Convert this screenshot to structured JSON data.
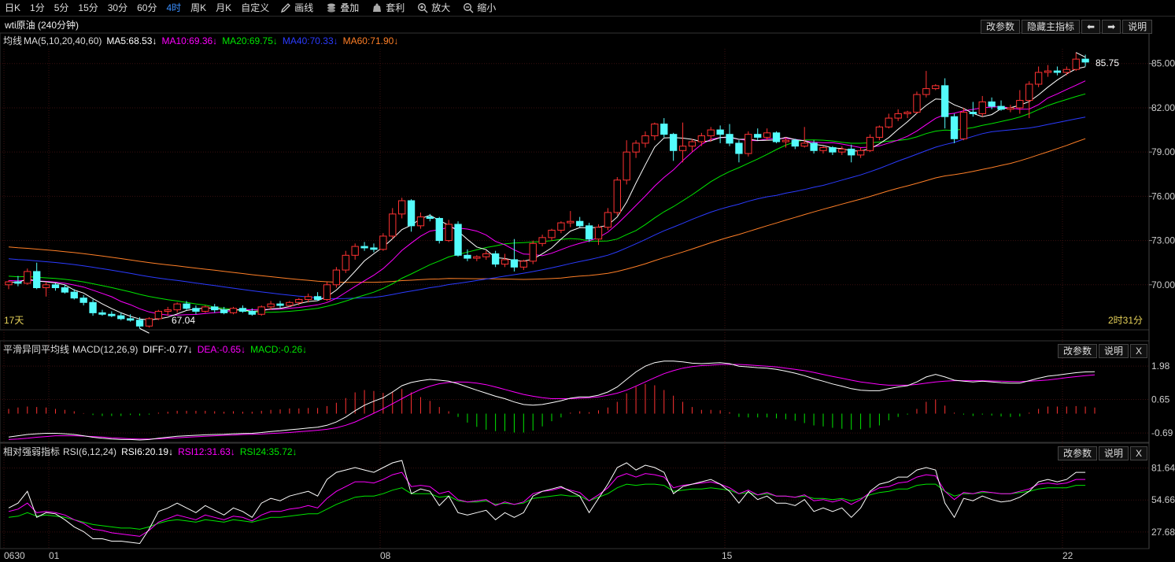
{
  "toolbar": {
    "periods": [
      "日K",
      "1分",
      "5分",
      "15分",
      "30分",
      "60分",
      "4时",
      "周K",
      "月K",
      "自定义"
    ],
    "active_period": "4时",
    "tools": [
      {
        "label": "画线",
        "icon": "pencil-icon"
      },
      {
        "label": "叠加",
        "icon": "stack-icon"
      },
      {
        "label": "套利",
        "icon": "bag-icon"
      },
      {
        "label": "放大",
        "icon": "zoom-in-icon"
      },
      {
        "label": "缩小",
        "icon": "zoom-out-icon"
      }
    ]
  },
  "title": "wti原油 (240分钟)",
  "main_panel": {
    "buttons": [
      "改参数",
      "隐藏主指标",
      "⬅",
      "➡",
      "说明"
    ],
    "legend": {
      "name": "均线",
      "params": "MA(5,10,20,40,60)",
      "ma5": "MA5:68.53↓",
      "ma10": "MA10:69.36↓",
      "ma20": "MA20:69.75↓",
      "ma40": "MA40:70.33↓",
      "ma60": "MA60:71.90↓"
    },
    "y_ticks": [
      "85.00",
      "82.00",
      "79.00",
      "76.00",
      "73.00",
      "70.00"
    ],
    "low_label": "67.04",
    "high_label": "85.75",
    "left_info": "17天",
    "right_info": "2时31分"
  },
  "macd_panel": {
    "buttons": [
      "改参数",
      "说明",
      "X"
    ],
    "legend": {
      "name": "平滑异同平均线",
      "params": "MACD(12,26,9)",
      "diff": "DIFF:-0.77↓",
      "dea": "DEA:-0.65↓",
      "macd": "MACD:-0.26↓"
    },
    "y_ticks": [
      "1.98",
      "0.65",
      "-0.69"
    ]
  },
  "rsi_panel": {
    "buttons": [
      "改参数",
      "说明",
      "X"
    ],
    "legend": {
      "name": "相对强弱指标",
      "params": "RSI(6,12,24)",
      "rsi6": "RSI6:20.19↓",
      "rsi12": "RSI12:31.63↓",
      "rsi24": "RSI24:35.72↓"
    },
    "y_ticks": [
      "81.64",
      "54.66",
      "27.68"
    ]
  },
  "x_labels": [
    "0630",
    "01",
    "08",
    "15",
    "22"
  ],
  "colors": {
    "up": "#ff3232",
    "down": "#54fcfc",
    "ma5": "#ffffff",
    "ma10": "#ff00ff",
    "ma20": "#00e600",
    "ma40": "#2b3bff",
    "ma60": "#ff7f27",
    "grid": "#3a1010",
    "legend_yellow": "#e8d35a"
  },
  "chart_data": {
    "type": "candlestick",
    "price_range": [
      67.0,
      86.0
    ],
    "candles": [
      [
        70.0,
        70.3,
        69.7,
        70.2
      ],
      [
        70.2,
        70.6,
        69.9,
        70.1
      ],
      [
        70.1,
        71.1,
        70.0,
        70.9
      ],
      [
        70.9,
        71.5,
        69.7,
        69.8
      ],
      [
        69.8,
        70.2,
        69.2,
        70.0
      ],
      [
        70.0,
        70.1,
        69.6,
        69.8
      ],
      [
        69.8,
        70.0,
        69.4,
        69.5
      ],
      [
        69.5,
        69.7,
        69.0,
        69.1
      ],
      [
        69.1,
        69.3,
        68.6,
        68.8
      ],
      [
        68.8,
        69.0,
        67.9,
        68.1
      ],
      [
        68.1,
        68.3,
        67.9,
        68.0
      ],
      [
        68.0,
        68.2,
        67.8,
        67.9
      ],
      [
        67.9,
        68.1,
        67.6,
        67.7
      ],
      [
        67.7,
        68.0,
        67.5,
        67.6
      ],
      [
        67.6,
        67.8,
        67.04,
        67.2
      ],
      [
        67.2,
        67.8,
        67.1,
        67.7
      ],
      [
        67.7,
        68.3,
        67.6,
        68.2
      ],
      [
        68.2,
        68.5,
        67.9,
        68.3
      ],
      [
        68.3,
        68.8,
        68.1,
        68.7
      ],
      [
        68.7,
        68.9,
        68.3,
        68.4
      ],
      [
        68.4,
        68.6,
        68.0,
        68.2
      ],
      [
        68.2,
        68.6,
        68.1,
        68.5
      ],
      [
        68.5,
        68.7,
        68.1,
        68.3
      ],
      [
        68.3,
        68.5,
        68.0,
        68.1
      ],
      [
        68.1,
        68.5,
        68.0,
        68.4
      ],
      [
        68.4,
        68.6,
        68.1,
        68.2
      ],
      [
        68.2,
        68.4,
        67.9,
        68.0
      ],
      [
        68.0,
        68.6,
        67.9,
        68.5
      ],
      [
        68.5,
        68.9,
        68.3,
        68.7
      ],
      [
        68.7,
        68.9,
        68.4,
        68.6
      ],
      [
        68.6,
        68.9,
        68.5,
        68.8
      ],
      [
        68.8,
        69.1,
        68.6,
        69.0
      ],
      [
        69.0,
        69.4,
        68.8,
        69.2
      ],
      [
        69.2,
        69.5,
        68.9,
        69.0
      ],
      [
        69.0,
        70.2,
        68.9,
        70.0
      ],
      [
        70.0,
        71.2,
        69.8,
        71.0
      ],
      [
        71.0,
        72.3,
        70.8,
        72.0
      ],
      [
        72.0,
        72.8,
        71.7,
        72.6
      ],
      [
        72.6,
        72.9,
        72.3,
        72.5
      ],
      [
        72.5,
        72.8,
        72.2,
        72.4
      ],
      [
        72.4,
        73.5,
        72.3,
        73.3
      ],
      [
        73.3,
        75.2,
        73.1,
        74.8
      ],
      [
        74.8,
        75.9,
        74.5,
        75.7
      ],
      [
        75.7,
        75.8,
        73.6,
        74.0
      ],
      [
        74.0,
        74.9,
        73.8,
        74.6
      ],
      [
        74.6,
        74.8,
        74.3,
        74.5
      ],
      [
        74.5,
        74.6,
        72.8,
        73.0
      ],
      [
        73.0,
        74.4,
        72.9,
        74.1
      ],
      [
        74.1,
        74.3,
        71.9,
        72.0
      ],
      [
        72.0,
        72.4,
        71.6,
        71.8
      ],
      [
        71.8,
        72.0,
        71.6,
        71.9
      ],
      [
        71.9,
        72.3,
        71.7,
        72.1
      ],
      [
        72.1,
        72.3,
        71.2,
        71.4
      ],
      [
        71.4,
        72.1,
        71.2,
        71.7
      ],
      [
        71.7,
        73.1,
        70.9,
        71.2
      ],
      [
        71.2,
        71.7,
        71.0,
        71.6
      ],
      [
        71.6,
        73.0,
        71.4,
        72.8
      ],
      [
        72.8,
        73.4,
        72.6,
        73.2
      ],
      [
        73.2,
        73.8,
        73.0,
        73.7
      ],
      [
        73.7,
        74.3,
        73.5,
        74.2
      ],
      [
        74.2,
        75.0,
        73.9,
        74.3
      ],
      [
        74.3,
        74.6,
        73.9,
        74.0
      ],
      [
        74.0,
        74.2,
        72.9,
        73.1
      ],
      [
        73.1,
        74.1,
        72.7,
        73.9
      ],
      [
        73.9,
        75.2,
        73.7,
        74.9
      ],
      [
        74.9,
        77.3,
        74.7,
        77.1
      ],
      [
        77.1,
        79.8,
        76.8,
        79.0
      ],
      [
        79.0,
        79.8,
        78.6,
        79.6
      ],
      [
        79.6,
        80.4,
        79.3,
        80.1
      ],
      [
        80.1,
        81.0,
        79.8,
        80.9
      ],
      [
        80.9,
        81.3,
        80.0,
        80.2
      ],
      [
        80.2,
        80.3,
        78.4,
        79.1
      ],
      [
        79.1,
        81.0,
        78.3,
        79.4
      ],
      [
        79.4,
        79.9,
        79.0,
        79.7
      ],
      [
        79.7,
        80.3,
        79.4,
        80.1
      ],
      [
        80.1,
        80.7,
        79.7,
        80.5
      ],
      [
        80.5,
        80.8,
        79.6,
        80.2
      ],
      [
        80.2,
        80.9,
        79.4,
        79.6
      ],
      [
        79.6,
        79.8,
        78.3,
        78.9
      ],
      [
        78.9,
        80.4,
        78.7,
        80.2
      ],
      [
        80.2,
        80.6,
        79.8,
        80.0
      ],
      [
        80.0,
        80.6,
        79.8,
        80.3
      ],
      [
        80.3,
        80.4,
        79.6,
        79.7
      ],
      [
        79.7,
        80.0,
        79.3,
        79.8
      ],
      [
        79.8,
        79.9,
        79.2,
        79.4
      ],
      [
        79.4,
        80.7,
        79.3,
        79.6
      ],
      [
        79.6,
        79.8,
        78.9,
        79.1
      ],
      [
        79.1,
        79.4,
        78.9,
        79.3
      ],
      [
        79.3,
        79.4,
        78.8,
        79.0
      ],
      [
        79.0,
        79.4,
        78.8,
        79.2
      ],
      [
        79.2,
        79.5,
        78.3,
        78.8
      ],
      [
        78.8,
        79.3,
        78.6,
        79.1
      ],
      [
        79.1,
        80.2,
        79.0,
        80.0
      ],
      [
        80.0,
        80.8,
        79.8,
        80.7
      ],
      [
        80.7,
        81.6,
        80.6,
        81.3
      ],
      [
        81.3,
        81.9,
        81.1,
        81.6
      ],
      [
        81.6,
        81.8,
        81.3,
        81.7
      ],
      [
        81.7,
        83.1,
        81.6,
        82.9
      ],
      [
        82.9,
        84.5,
        82.7,
        83.3
      ],
      [
        83.3,
        83.6,
        83.2,
        83.5
      ],
      [
        83.5,
        84.0,
        80.6,
        81.4
      ],
      [
        81.4,
        81.6,
        79.6,
        79.9
      ],
      [
        79.9,
        82.0,
        79.8,
        81.7
      ],
      [
        81.7,
        82.4,
        81.4,
        81.6
      ],
      [
        81.6,
        82.8,
        81.4,
        82.4
      ],
      [
        82.4,
        82.7,
        81.9,
        82.1
      ],
      [
        82.1,
        82.5,
        81.8,
        81.9
      ],
      [
        81.9,
        82.2,
        81.7,
        82.0
      ],
      [
        82.0,
        83.2,
        81.6,
        82.5
      ],
      [
        82.5,
        83.8,
        81.3,
        83.6
      ],
      [
        83.6,
        84.8,
        83.4,
        84.4
      ],
      [
        84.4,
        84.9,
        84.1,
        84.5
      ],
      [
        84.5,
        84.8,
        84.2,
        84.4
      ],
      [
        84.4,
        84.8,
        84.2,
        84.6
      ],
      [
        84.6,
        85.75,
        84.5,
        85.3
      ],
      [
        85.3,
        85.6,
        84.8,
        85.1
      ]
    ],
    "macd": {
      "range": [
        -1.0,
        2.3
      ],
      "diff": [
        -0.85,
        -0.8,
        -0.75,
        -0.72,
        -0.7,
        -0.7,
        -0.72,
        -0.75,
        -0.8,
        -0.86,
        -0.9,
        -0.93,
        -0.95,
        -0.95,
        -0.97,
        -0.95,
        -0.9,
        -0.86,
        -0.82,
        -0.8,
        -0.78,
        -0.76,
        -0.75,
        -0.74,
        -0.72,
        -0.71,
        -0.7,
        -0.67,
        -0.63,
        -0.6,
        -0.56,
        -0.53,
        -0.49,
        -0.46,
        -0.38,
        -0.25,
        -0.05,
        0.2,
        0.42,
        0.58,
        0.72,
        0.95,
        1.2,
        1.33,
        1.4,
        1.45,
        1.42,
        1.38,
        1.28,
        1.15,
        1.02,
        0.9,
        0.78,
        0.68,
        0.55,
        0.45,
        0.42,
        0.45,
        0.52,
        0.6,
        0.7,
        0.75,
        0.75,
        0.82,
        0.95,
        1.15,
        1.45,
        1.75,
        1.98,
        2.12,
        2.18,
        2.18,
        2.15,
        2.1,
        2.08,
        2.1,
        2.12,
        2.08,
        1.98,
        1.95,
        1.92,
        1.9,
        1.85,
        1.78,
        1.7,
        1.6,
        1.48,
        1.38,
        1.27,
        1.18,
        1.08,
        1.02,
        1.0,
        1.0,
        1.08,
        1.15,
        1.2,
        1.35,
        1.55,
        1.65,
        1.55,
        1.42,
        1.38,
        1.35,
        1.38,
        1.35,
        1.32,
        1.3,
        1.3,
        1.4,
        1.5,
        1.58,
        1.62,
        1.67,
        1.72,
        1.75,
        1.76
      ],
      "dea": [
        -0.95,
        -0.93,
        -0.9,
        -0.86,
        -0.83,
        -0.8,
        -0.8,
        -0.8,
        -0.81,
        -0.83,
        -0.85,
        -0.88,
        -0.9,
        -0.92,
        -0.93,
        -0.93,
        -0.92,
        -0.9,
        -0.88,
        -0.86,
        -0.84,
        -0.82,
        -0.8,
        -0.78,
        -0.77,
        -0.75,
        -0.74,
        -0.73,
        -0.71,
        -0.69,
        -0.67,
        -0.64,
        -0.61,
        -0.58,
        -0.54,
        -0.48,
        -0.38,
        -0.25,
        -0.08,
        0.1,
        0.28,
        0.48,
        0.68,
        0.88,
        1.05,
        1.18,
        1.28,
        1.33,
        1.35,
        1.34,
        1.3,
        1.24,
        1.15,
        1.05,
        0.95,
        0.85,
        0.78,
        0.72,
        0.68,
        0.68,
        0.68,
        0.7,
        0.72,
        0.75,
        0.82,
        0.9,
        1.02,
        1.18,
        1.35,
        1.52,
        1.68,
        1.8,
        1.9,
        1.96,
        2.0,
        2.02,
        2.05,
        2.05,
        2.05,
        2.03,
        2.0,
        1.98,
        1.95,
        1.9,
        1.85,
        1.8,
        1.73,
        1.65,
        1.57,
        1.5,
        1.42,
        1.35,
        1.3,
        1.25,
        1.22,
        1.22,
        1.22,
        1.25,
        1.3,
        1.35,
        1.38,
        1.4,
        1.4,
        1.4,
        1.4,
        1.39,
        1.38,
        1.37,
        1.36,
        1.38,
        1.4,
        1.43,
        1.47,
        1.52,
        1.56,
        1.6,
        1.63
      ]
    },
    "rsi": {
      "range": [
        15,
        88
      ],
      "rsi6": [
        48,
        52,
        62,
        40,
        44,
        43,
        38,
        32,
        28,
        22,
        22,
        20,
        20,
        19,
        18,
        30,
        45,
        48,
        52,
        48,
        44,
        50,
        46,
        42,
        48,
        45,
        40,
        52,
        56,
        54,
        58,
        60,
        62,
        58,
        72,
        78,
        80,
        82,
        80,
        78,
        82,
        86,
        88,
        60,
        64,
        62,
        50,
        58,
        44,
        42,
        44,
        46,
        38,
        44,
        40,
        44,
        58,
        62,
        64,
        66,
        62,
        58,
        44,
        56,
        68,
        82,
        86,
        80,
        84,
        82,
        78,
        60,
        66,
        68,
        70,
        72,
        68,
        62,
        52,
        62,
        55,
        58,
        52,
        52,
        50,
        55,
        45,
        48,
        45,
        48,
        40,
        48,
        62,
        68,
        70,
        74,
        74,
        80,
        82,
        80,
        52,
        40,
        56,
        54,
        58,
        55,
        53,
        54,
        57,
        62,
        70,
        72,
        70,
        72,
        78,
        78
      ],
      "rsi12": [
        45,
        47,
        52,
        44,
        45,
        44,
        42,
        38,
        35,
        30,
        29,
        27,
        26,
        25,
        24,
        29,
        36,
        39,
        42,
        40,
        38,
        42,
        40,
        38,
        41,
        40,
        37,
        42,
        45,
        45,
        47,
        48,
        50,
        48,
        56,
        62,
        66,
        70,
        70,
        69,
        72,
        76,
        78,
        66,
        67,
        66,
        60,
        62,
        55,
        53,
        54,
        55,
        50,
        53,
        51,
        53,
        60,
        62,
        63,
        65,
        63,
        61,
        54,
        59,
        65,
        74,
        77,
        74,
        77,
        76,
        74,
        65,
        67,
        68,
        69,
        70,
        68,
        65,
        60,
        63,
        59,
        61,
        58,
        58,
        57,
        59,
        54,
        55,
        53,
        55,
        51,
        55,
        61,
        65,
        66,
        69,
        70,
        74,
        76,
        75,
        62,
        55,
        61,
        60,
        62,
        61,
        60,
        60,
        62,
        64,
        68,
        69,
        68,
        69,
        72,
        72
      ],
      "rsi24": [
        40,
        41,
        44,
        41,
        42,
        41,
        40,
        38,
        36,
        34,
        33,
        32,
        31,
        31,
        30,
        32,
        35,
        37,
        38,
        37,
        36,
        38,
        37,
        36,
        38,
        37,
        36,
        38,
        40,
        40,
        41,
        42,
        43,
        43,
        47,
        51,
        54,
        57,
        58,
        58,
        60,
        63,
        65,
        60,
        60,
        60,
        57,
        58,
        54,
        53,
        53,
        54,
        51,
        52,
        51,
        52,
        56,
        57,
        58,
        59,
        58,
        58,
        54,
        57,
        60,
        65,
        68,
        67,
        68,
        68,
        67,
        62,
        63,
        64,
        64,
        65,
        64,
        63,
        60,
        61,
        59,
        60,
        58,
        58,
        57,
        58,
        56,
        56,
        55,
        56,
        54,
        56,
        59,
        61,
        62,
        64,
        64,
        67,
        68,
        68,
        62,
        58,
        60,
        60,
        61,
        61,
        60,
        60,
        61,
        62,
        64,
        65,
        65,
        65,
        67,
        67
      ]
    }
  }
}
